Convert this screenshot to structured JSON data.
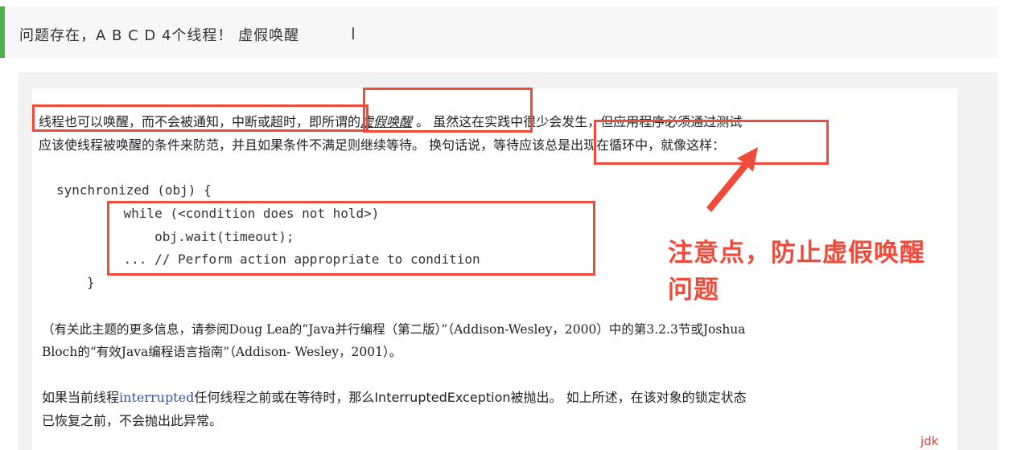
{
  "header": {
    "quote": "问题存在，A B C D 4个线程！ 虚假唤醒",
    "caret": "I"
  },
  "doc": {
    "p1_a": "线程也可以唤醒，而不会被通知，中断或超时，",
    "p1_b": "即所谓的",
    "p1_em": "虚假唤醒",
    "p1_c": " 。 虽然这在实践中很少会发生，但应用程序必须通过测试",
    "p2": "应该使线程被唤醒的条件来防范，并且如果条件不满足则继续等待。 换句话说，等待应该总是出现在循环中，就像这样：",
    "code": {
      "line1": "synchronized (obj) {",
      "line2": "    while (<condition does not hold>)",
      "line3": "        obj.wait(timeout);",
      "line4": "    ... // Perform action appropriate to condition",
      "line5": "}"
    },
    "ref1": "（有关此主题的更多信息，请参阅Doug Lea的“Java并行编程（第二版）”（Addison-Wesley，2000）中的第3.2.3节或Joshua",
    "ref2": "Bloch的“有效Java编程语言指南”（Addison- Wesley，2001）。",
    "int_a": "如果当前线程",
    "int_link": "interrupted",
    "int_b": "任何线程之前或在等待时，那么InterruptedException被抛出。 如上所述，在该对象的锁定状态",
    "int2": "已恢复之前，不会抛出此异常。"
  },
  "annotation": {
    "line1": "注意点，防止虚假唤醒",
    "line2": "问题"
  },
  "watermark": "jdk",
  "colors": {
    "accent_bar": "#4caf50",
    "highlight": "#f04a3a"
  }
}
